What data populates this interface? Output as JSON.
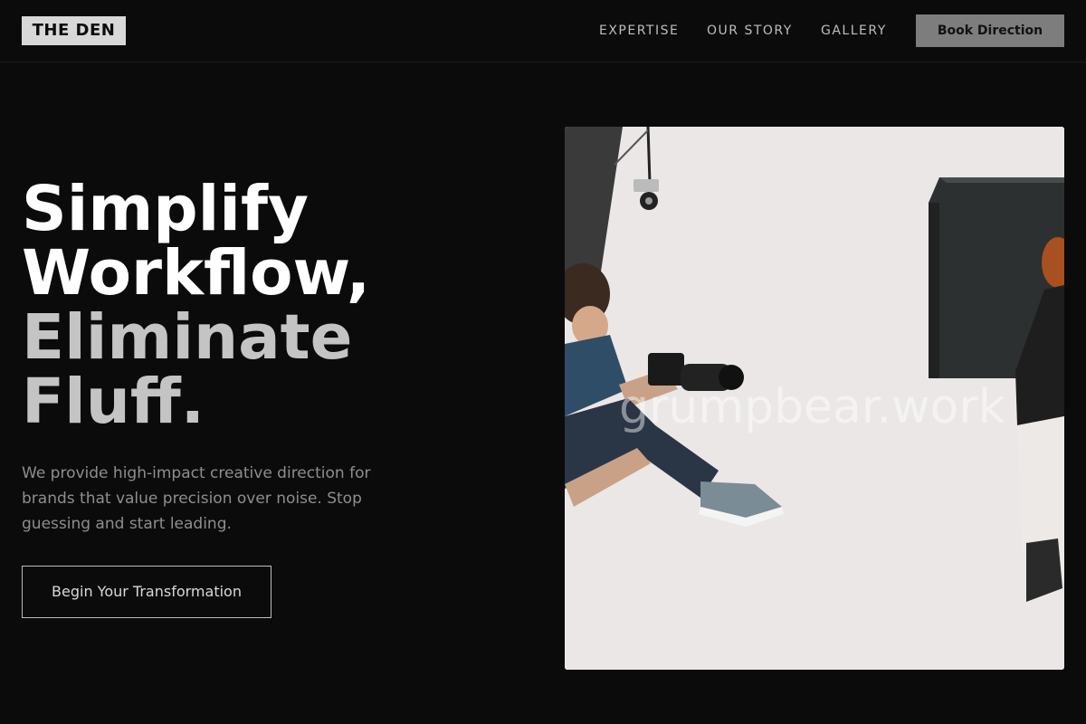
{
  "header": {
    "logo": "THE DEN",
    "nav": [
      "EXPERTISE",
      "OUR STORY",
      "GALLERY"
    ],
    "book_label": "Book Direction"
  },
  "hero": {
    "title_lines": [
      "Simplify",
      "Workflow,",
      "Eliminate",
      "Fluff."
    ],
    "subtitle": "We provide high-impact creative direction for brands that value precision over noise. Stop guessing and start leading.",
    "cta_label": "Begin Your Transformation"
  },
  "photo": {
    "watermark": "grumpbear.work"
  },
  "colors": {
    "background": "#0b0b0b",
    "logo_bg": "#d8d8d8",
    "button_bg": "#7d7d7d",
    "muted_heading": "#c4c4c4",
    "body_text": "#8e8e8e"
  }
}
